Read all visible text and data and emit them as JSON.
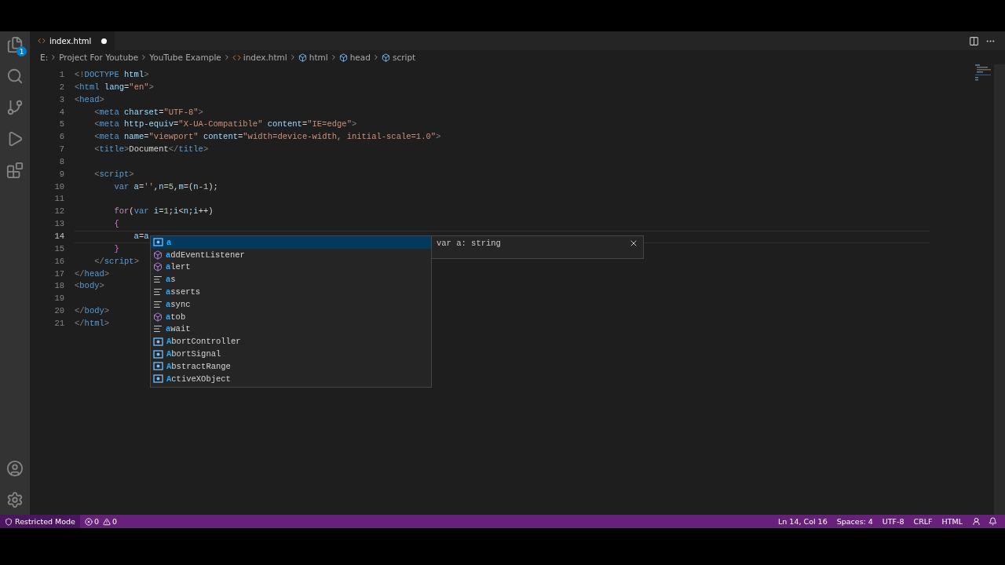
{
  "activity_bar": {
    "explorer_badge": "1"
  },
  "tab": {
    "label": "index.html",
    "modified": true
  },
  "breadcrumbs": [
    {
      "kind": "text",
      "label": "E:"
    },
    {
      "kind": "text",
      "label": "Project For Youtube"
    },
    {
      "kind": "text",
      "label": "YouTube Example"
    },
    {
      "kind": "file",
      "label": "index.html"
    },
    {
      "kind": "element",
      "label": "html"
    },
    {
      "kind": "element",
      "label": "head"
    },
    {
      "kind": "element",
      "label": "script"
    }
  ],
  "lines": [
    {
      "number": "1",
      "current": false,
      "tokens": [
        {
          "kind": "p",
          "text": "<!"
        },
        {
          "kind": "tag",
          "text": "DOCTYPE"
        },
        {
          "kind": "attr",
          "text": " html"
        },
        {
          "kind": "p",
          "text": ">"
        }
      ]
    },
    {
      "number": "2",
      "current": false,
      "tokens": [
        {
          "kind": "p",
          "text": "<"
        },
        {
          "kind": "tag",
          "text": "html"
        },
        {
          "kind": "attr",
          "text": " lang"
        },
        {
          "kind": "txt",
          "text": "="
        },
        {
          "kind": "str",
          "text": "\"en\""
        },
        {
          "kind": "p",
          "text": ">"
        }
      ]
    },
    {
      "number": "3",
      "current": false,
      "tokens": [
        {
          "kind": "p",
          "text": "<"
        },
        {
          "kind": "tag",
          "text": "head"
        },
        {
          "kind": "p",
          "text": ">"
        }
      ]
    },
    {
      "number": "4",
      "current": false,
      "tokens": [
        {
          "kind": "p",
          "text": "    <"
        },
        {
          "kind": "tag",
          "text": "meta"
        },
        {
          "kind": "attr",
          "text": " charset"
        },
        {
          "kind": "txt",
          "text": "="
        },
        {
          "kind": "str",
          "text": "\"UTF-8\""
        },
        {
          "kind": "p",
          "text": ">"
        }
      ]
    },
    {
      "number": "5",
      "current": false,
      "tokens": [
        {
          "kind": "p",
          "text": "    <"
        },
        {
          "kind": "tag",
          "text": "meta"
        },
        {
          "kind": "attr",
          "text": " http-equiv"
        },
        {
          "kind": "txt",
          "text": "="
        },
        {
          "kind": "str",
          "text": "\"X-UA-Compatible\""
        },
        {
          "kind": "attr",
          "text": " content"
        },
        {
          "kind": "txt",
          "text": "="
        },
        {
          "kind": "str",
          "text": "\"IE=edge\""
        },
        {
          "kind": "p",
          "text": ">"
        }
      ]
    },
    {
      "number": "6",
      "current": false,
      "tokens": [
        {
          "kind": "p",
          "text": "    <"
        },
        {
          "kind": "tag",
          "text": "meta"
        },
        {
          "kind": "attr",
          "text": " name"
        },
        {
          "kind": "txt",
          "text": "="
        },
        {
          "kind": "str",
          "text": "\"viewport\""
        },
        {
          "kind": "attr",
          "text": " content"
        },
        {
          "kind": "txt",
          "text": "="
        },
        {
          "kind": "str",
          "text": "\"width=device-width, initial-scale=1.0\""
        },
        {
          "kind": "p",
          "text": ">"
        }
      ]
    },
    {
      "number": "7",
      "current": false,
      "tokens": [
        {
          "kind": "p",
          "text": "    <"
        },
        {
          "kind": "tag",
          "text": "title"
        },
        {
          "kind": "p",
          "text": ">"
        },
        {
          "kind": "txt",
          "text": "Document"
        },
        {
          "kind": "p",
          "text": "</"
        },
        {
          "kind": "tag",
          "text": "title"
        },
        {
          "kind": "p",
          "text": ">"
        }
      ]
    },
    {
      "number": "8",
      "current": false
    },
    {
      "number": "9",
      "current": false,
      "tokens": [
        {
          "kind": "p",
          "text": "    <"
        },
        {
          "kind": "tag",
          "text": "script"
        },
        {
          "kind": "p",
          "text": ">"
        }
      ]
    },
    {
      "number": "10",
      "current": false,
      "tokens": [
        {
          "kind": "kw",
          "text": "        var"
        },
        {
          "kind": "var",
          "text": " a"
        },
        {
          "kind": "txt",
          "text": "="
        },
        {
          "kind": "str",
          "text": "''"
        },
        {
          "kind": "txt",
          "text": ","
        },
        {
          "kind": "var",
          "text": "n"
        },
        {
          "kind": "txt",
          "text": "="
        },
        {
          "kind": "num",
          "text": "5"
        },
        {
          "kind": "txt",
          "text": ","
        },
        {
          "kind": "var",
          "text": "m"
        },
        {
          "kind": "txt",
          "text": "=("
        },
        {
          "kind": "var",
          "text": "n"
        },
        {
          "kind": "txt",
          "text": "-"
        },
        {
          "kind": "num",
          "text": "1"
        },
        {
          "kind": "txt",
          "text": ");"
        }
      ]
    },
    {
      "number": "11",
      "current": false
    },
    {
      "number": "12",
      "current": false,
      "tokens": [
        {
          "kind": "ctl",
          "text": "        for"
        },
        {
          "kind": "txt",
          "text": "("
        },
        {
          "kind": "kw",
          "text": "var"
        },
        {
          "kind": "var",
          "text": " i"
        },
        {
          "kind": "txt",
          "text": "="
        },
        {
          "kind": "num",
          "text": "1"
        },
        {
          "kind": "txt",
          "text": ";"
        },
        {
          "kind": "var",
          "text": "i"
        },
        {
          "kind": "txt",
          "text": "<"
        },
        {
          "kind": "var",
          "text": "n"
        },
        {
          "kind": "txt",
          "text": ";"
        },
        {
          "kind": "var",
          "text": "i"
        },
        {
          "kind": "txt",
          "text": "++)"
        }
      ]
    },
    {
      "number": "13",
      "current": false,
      "tokens": [
        {
          "kind": "brace",
          "text": "        {"
        }
      ]
    },
    {
      "number": "14",
      "current": true,
      "tokens": [
        {
          "kind": "var",
          "text": "            a"
        },
        {
          "kind": "txt",
          "text": "="
        },
        {
          "kind": "var",
          "text": "a"
        }
      ]
    },
    {
      "number": "15",
      "current": false,
      "tokens": [
        {
          "kind": "brace",
          "text": "        }"
        }
      ]
    },
    {
      "number": "16",
      "current": false,
      "tokens": [
        {
          "kind": "p",
          "text": "    </"
        },
        {
          "kind": "tag",
          "text": "script"
        },
        {
          "kind": "p",
          "text": ">"
        }
      ]
    },
    {
      "number": "17",
      "current": false,
      "tokens": [
        {
          "kind": "p",
          "text": "</"
        },
        {
          "kind": "tag",
          "text": "head"
        },
        {
          "kind": "p",
          "text": ">"
        }
      ]
    },
    {
      "number": "18",
      "current": false,
      "tokens": [
        {
          "kind": "p",
          "text": "<"
        },
        {
          "kind": "tag",
          "text": "body"
        },
        {
          "kind": "p",
          "text": ">"
        }
      ]
    },
    {
      "number": "19",
      "current": false
    },
    {
      "number": "20",
      "current": false,
      "tokens": [
        {
          "kind": "p",
          "text": "</"
        },
        {
          "kind": "tag",
          "text": "body"
        },
        {
          "kind": "p",
          "text": ">"
        }
      ]
    },
    {
      "number": "21",
      "current": false,
      "tokens": [
        {
          "kind": "p",
          "text": "</"
        },
        {
          "kind": "tag",
          "text": "html"
        },
        {
          "kind": "p",
          "text": ">"
        }
      ]
    }
  ],
  "suggestions": [
    {
      "kind": "variable",
      "match": "a",
      "selected": true
    },
    {
      "kind": "method",
      "match": "a",
      "rest": "ddEventListener",
      "selected": false
    },
    {
      "kind": "method",
      "match": "a",
      "rest": "lert",
      "selected": false
    },
    {
      "kind": "keyword",
      "match": "a",
      "rest": "s",
      "selected": false
    },
    {
      "kind": "keyword",
      "match": "a",
      "rest": "sserts",
      "selected": false
    },
    {
      "kind": "keyword",
      "match": "a",
      "rest": "sync",
      "selected": false
    },
    {
      "kind": "method",
      "match": "a",
      "rest": "tob",
      "selected": false
    },
    {
      "kind": "keyword",
      "match": "a",
      "rest": "wait",
      "selected": false
    },
    {
      "kind": "variable",
      "match": "A",
      "rest": "bortController",
      "selected": false
    },
    {
      "kind": "variable",
      "match": "A",
      "rest": "bortSignal",
      "selected": false
    },
    {
      "kind": "variable",
      "match": "A",
      "rest": "bstractRange",
      "selected": false
    },
    {
      "kind": "variable",
      "match": "A",
      "rest": "ctiveXObject",
      "selected": false
    }
  ],
  "details": {
    "text": "var a: string"
  },
  "status_bar": {
    "mode": "Restricted Mode",
    "errors": "0",
    "warnings": "0",
    "items": [
      "Ln 14, Col 16",
      "Spaces: 4",
      "UTF-8",
      "CRLF",
      "HTML"
    ]
  }
}
